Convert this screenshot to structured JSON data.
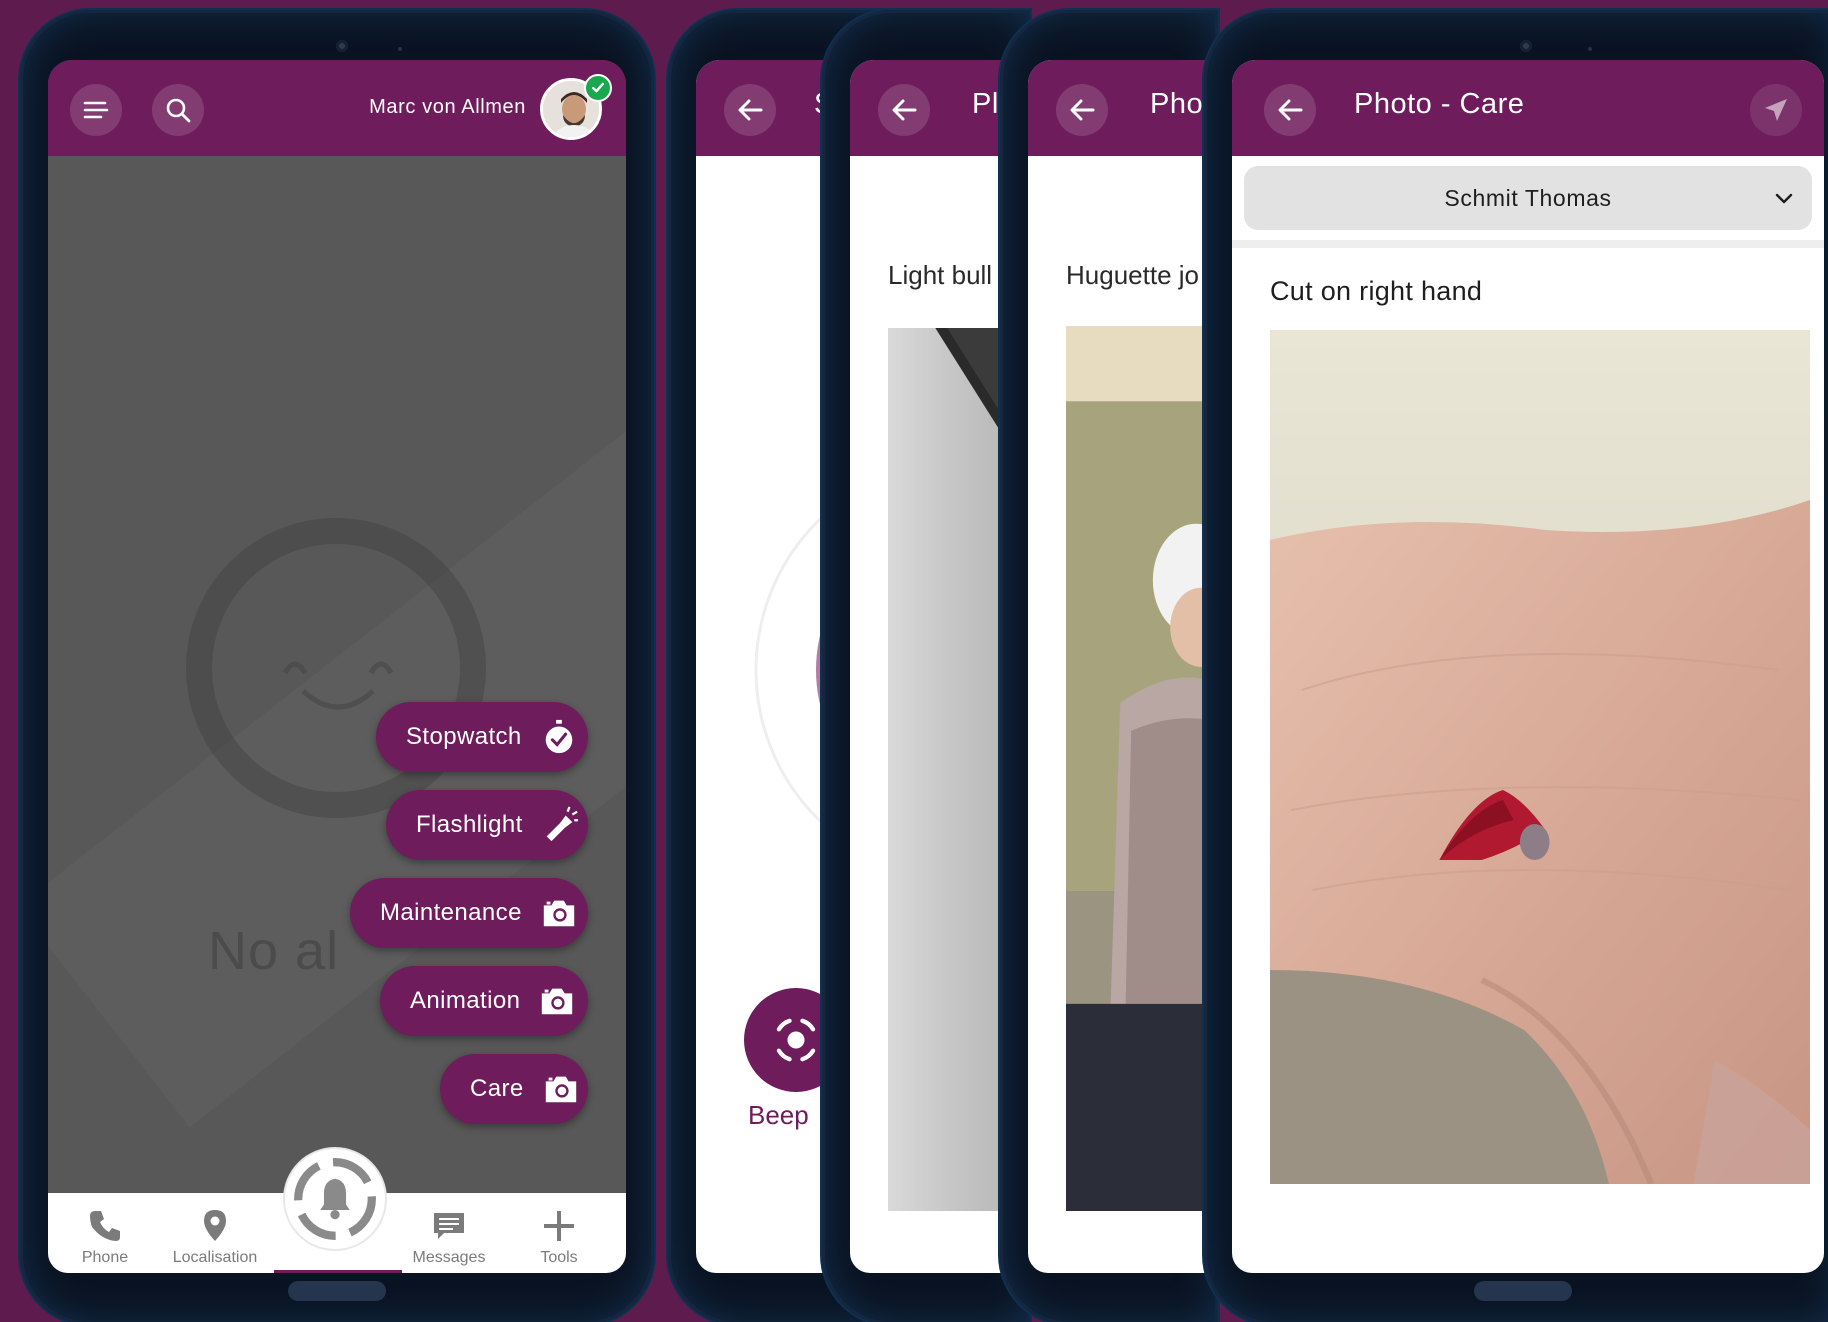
{
  "user": {
    "name": "Marc von Allmen"
  },
  "home": {
    "ghost_text": "No al",
    "actions": [
      {
        "label": "Stopwatch",
        "icon": "stopwatch-icon"
      },
      {
        "label": "Flashlight",
        "icon": "flashlight-icon"
      },
      {
        "label": "Maintenance",
        "icon": "camera-icon"
      },
      {
        "label": "Animation",
        "icon": "camera-icon"
      },
      {
        "label": "Care",
        "icon": "camera-icon"
      }
    ],
    "nav": [
      {
        "label": "Phone",
        "icon": "phone-icon"
      },
      {
        "label": "Localisation",
        "icon": "location-pin-icon"
      },
      {
        "label": "Messages",
        "icon": "message-icon"
      },
      {
        "label": "Tools",
        "icon": "plus-icon"
      }
    ]
  },
  "beep_screen": {
    "title_fragment": "S",
    "beep_label": "Beep"
  },
  "maintenance_screen": {
    "title_fragment": "Pl",
    "heading": "Light bull"
  },
  "animation_screen": {
    "title_fragment": "Pho",
    "heading": "Huguette jo"
  },
  "care_screen": {
    "title": "Photo - Care",
    "selected_person": "Schmit Thomas",
    "photo_title": "Cut on right hand"
  },
  "colors": {
    "brand": "#6e1c5b",
    "background": "#5e1c4e",
    "status_ok": "#1aa84e"
  }
}
